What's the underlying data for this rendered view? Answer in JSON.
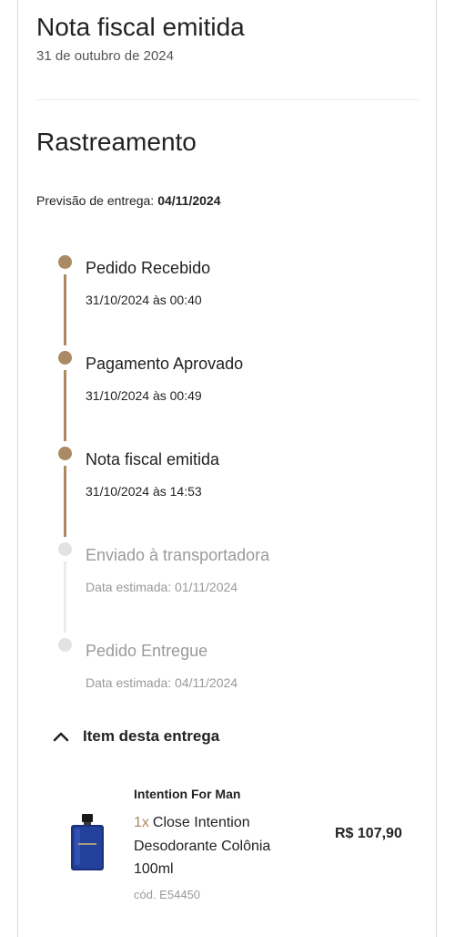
{
  "header": {
    "title": "Nota fiscal emitida",
    "date": "31 de outubro de 2024"
  },
  "tracking": {
    "title": "Rastreamento",
    "forecast_label": "Previsão de entrega:",
    "forecast_value": "04/11/2024",
    "steps": [
      {
        "label": "Pedido Recebido",
        "date": "31/10/2024 às 00:40",
        "status": "done"
      },
      {
        "label": "Pagamento Aprovado",
        "date": "31/10/2024 às 00:49",
        "status": "done"
      },
      {
        "label": "Nota fiscal emitida",
        "date": "31/10/2024 às 14:53",
        "status": "done"
      },
      {
        "label": "Enviado à transportadora",
        "date": "Data estimada: 01/11/2024",
        "status": "pending"
      },
      {
        "label": "Pedido Entregue",
        "date": "Data estimada: 04/11/2024",
        "status": "pending"
      }
    ]
  },
  "items": {
    "toggle_label": "Item desta entrega",
    "toggle_icon": "chevron-up-icon",
    "product": {
      "brand": "Intention For Man",
      "quantity": "1x",
      "name": "Close Intention Desodorante Colônia 100ml",
      "sku": "cód. E54450",
      "price": "R$ 107,90",
      "image_icon": "perfume-bottle-icon"
    }
  },
  "colors": {
    "accent": "#a98a63",
    "pending": "#e2e2e2",
    "muted_text": "#9a9a9a"
  }
}
